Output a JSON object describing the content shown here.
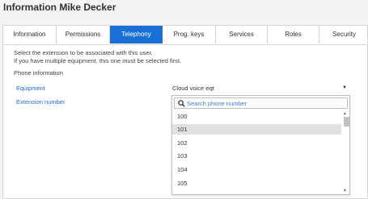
{
  "page": {
    "title": "Information Mike Decker"
  },
  "tabs": [
    {
      "label": "Information",
      "active": false
    },
    {
      "label": "Permissions",
      "active": false
    },
    {
      "label": "Telephony",
      "active": true
    },
    {
      "label": "Prog. keys",
      "active": false
    },
    {
      "label": "Services",
      "active": false
    },
    {
      "label": "Roles",
      "active": false
    },
    {
      "label": "Security",
      "active": false
    }
  ],
  "content": {
    "intro_line1": "Select the extension to be associated with this user.",
    "intro_line2": "If you have multiple equipment, this one must be selected first.",
    "section_label": "Phone information",
    "equipment_label": "Equipment",
    "equipment_value": "Cloud voice eqt",
    "extension_label": "Extension number"
  },
  "dropdown": {
    "search_placeholder": "Search phone number",
    "options": [
      "100",
      "101",
      "102",
      "103",
      "104",
      "105"
    ],
    "highlighted_index": 1
  },
  "colors": {
    "accent": "#1a6fd6",
    "highlight": "#e1e1e1"
  },
  "icons": {
    "search": "search-icon",
    "select_arrow": "chevron-down-icon"
  }
}
